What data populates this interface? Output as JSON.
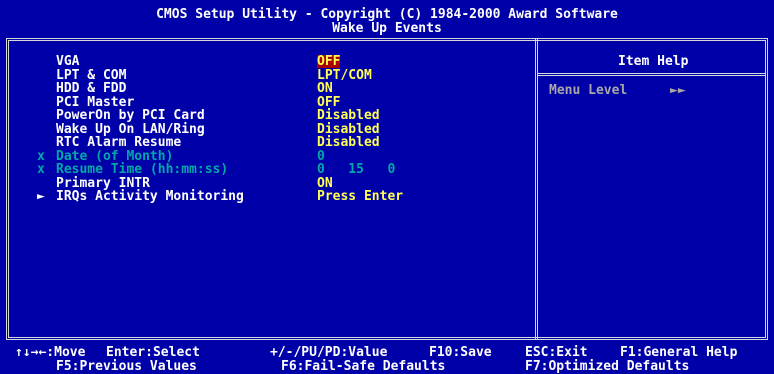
{
  "header": {
    "title": "CMOS Setup Utility - Copyright (C) 1984-2000 Award Software",
    "subtitle": "Wake Up Events"
  },
  "items": [
    {
      "prefix": "",
      "label": "VGA",
      "value": "OFF",
      "disabled": false,
      "selected": true
    },
    {
      "prefix": "",
      "label": "LPT & COM",
      "value": "LPT/COM",
      "disabled": false,
      "selected": false
    },
    {
      "prefix": "",
      "label": "HDD & FDD",
      "value": "ON",
      "disabled": false,
      "selected": false
    },
    {
      "prefix": "",
      "label": "PCI Master",
      "value": "OFF",
      "disabled": false,
      "selected": false
    },
    {
      "prefix": "",
      "label": "PowerOn by PCI Card",
      "value": "Disabled",
      "disabled": false,
      "selected": false
    },
    {
      "prefix": "",
      "label": "Wake Up On LAN/Ring",
      "value": "Disabled",
      "disabled": false,
      "selected": false
    },
    {
      "prefix": "",
      "label": "RTC Alarm Resume",
      "value": "Disabled",
      "disabled": false,
      "selected": false
    },
    {
      "prefix": "x",
      "label": "Date (of Month)",
      "value": "0",
      "disabled": true,
      "selected": false
    },
    {
      "prefix": "x",
      "label": "Resume Time (hh:mm:ss)",
      "value": "0   15   0",
      "disabled": true,
      "selected": false
    },
    {
      "prefix": "",
      "label": "Primary INTR",
      "value": "ON",
      "disabled": false,
      "selected": false
    },
    {
      "prefix": "►",
      "label": "IRQs Activity Monitoring",
      "value": "Press Enter",
      "disabled": false,
      "selected": false
    }
  ],
  "help": {
    "title": "Item Help",
    "menu_level_label": "Menu Level",
    "menu_level_value": "►►"
  },
  "footer": {
    "line1": {
      "move": "↑↓→←:Move",
      "select": "Enter:Select",
      "value": "+/-/PU/PD:Value",
      "save": "F10:Save",
      "exit": "ESC:Exit",
      "help": "F1:General Help"
    },
    "line2": {
      "previous": "F5:Previous Values",
      "failsafe": "F6:Fail-Safe Defaults",
      "optimized": "F7:Optimized Defaults"
    }
  },
  "colors": {
    "background": "#0000a8",
    "value": "#ffff54",
    "disabled": "#00a8a8",
    "selection": "#a80000"
  }
}
